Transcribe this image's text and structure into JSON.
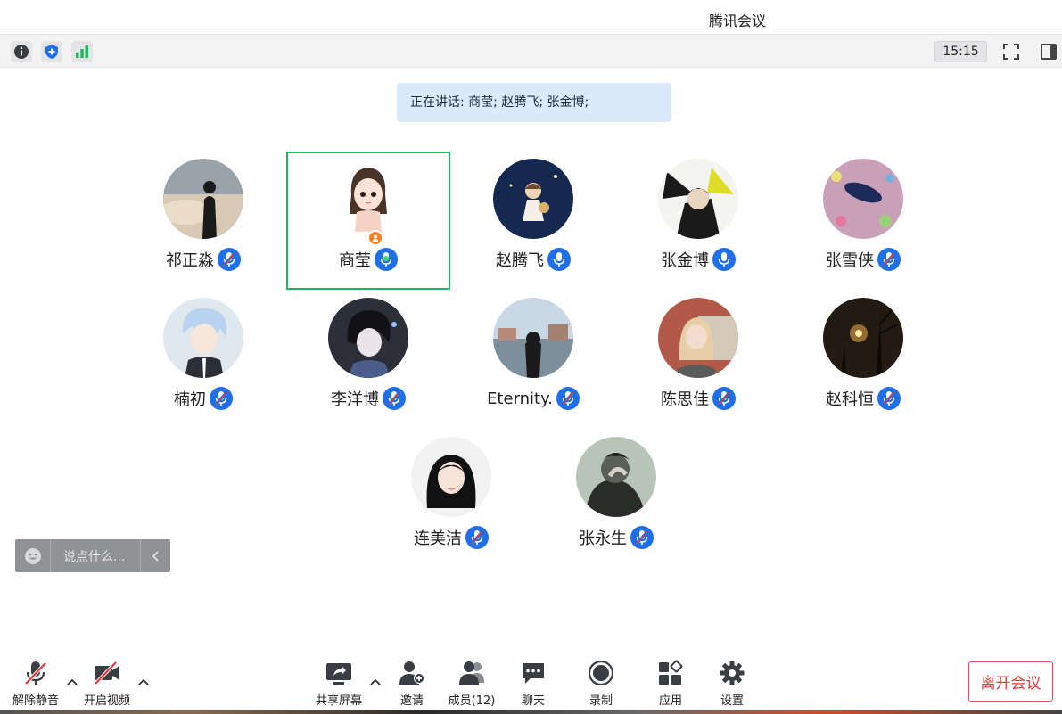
{
  "window": {
    "title": "腾讯会议"
  },
  "statusbar": {
    "time": "15:15"
  },
  "speaking": {
    "text": "正在讲话: 商莹; 赵腾飞; 张金博;"
  },
  "participants": [
    {
      "name": "祁正淼",
      "mic": "muted",
      "active": false
    },
    {
      "name": "商莹",
      "mic": "speaking",
      "active": true,
      "host": true
    },
    {
      "name": "赵腾飞",
      "mic": "on",
      "active": false
    },
    {
      "name": "张金博",
      "mic": "on",
      "active": false
    },
    {
      "name": "张雪侠",
      "mic": "muted",
      "active": false
    },
    {
      "name": "楠初",
      "mic": "muted",
      "active": false
    },
    {
      "name": "李洋博",
      "mic": "muted",
      "active": false
    },
    {
      "name": "Eternity.",
      "mic": "muted",
      "active": false
    },
    {
      "name": "陈思佳",
      "mic": "muted",
      "active": false
    },
    {
      "name": "赵科恒",
      "mic": "muted",
      "active": false
    },
    {
      "name": "连美洁",
      "mic": "muted",
      "active": false
    },
    {
      "name": "张永生",
      "mic": "muted",
      "active": false
    }
  ],
  "chat": {
    "placeholder": "说点什么..."
  },
  "toolbar": {
    "unmute": "解除静音",
    "start_video": "开启视频",
    "share_screen": "共享屏幕",
    "invite": "邀请",
    "members": "成员(12)",
    "chat": "聊天",
    "record": "录制",
    "apps": "应用",
    "settings": "设置",
    "leave": "离开会议"
  },
  "colors": {
    "accent": "#1f6fe8",
    "active_border": "#22b35e",
    "leave": "#e03a3a",
    "speaking_bg": "#dbe9fb"
  }
}
